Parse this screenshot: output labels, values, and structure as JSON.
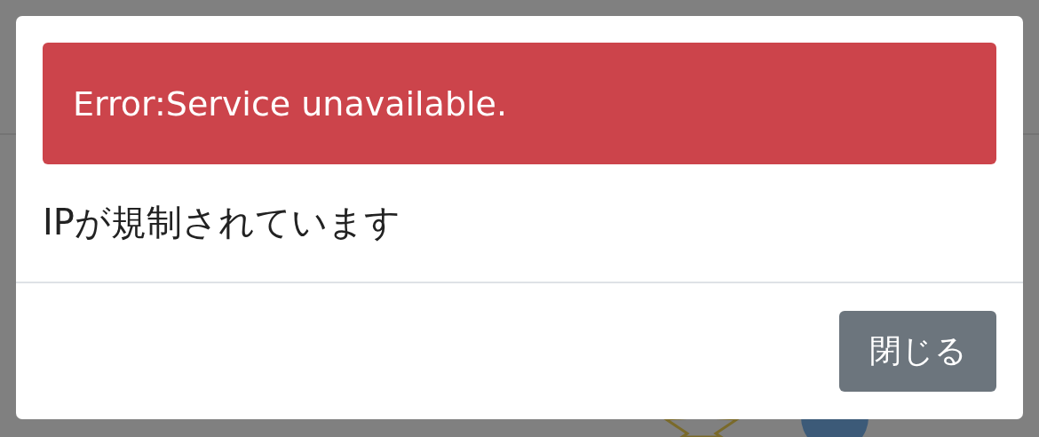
{
  "modal": {
    "alert": {
      "text": "Error:Service unavailable.",
      "kind": "danger"
    },
    "message": "IPが規制されています",
    "buttons": [
      {
        "label": "閉じる",
        "kind": "secondary"
      }
    ]
  }
}
